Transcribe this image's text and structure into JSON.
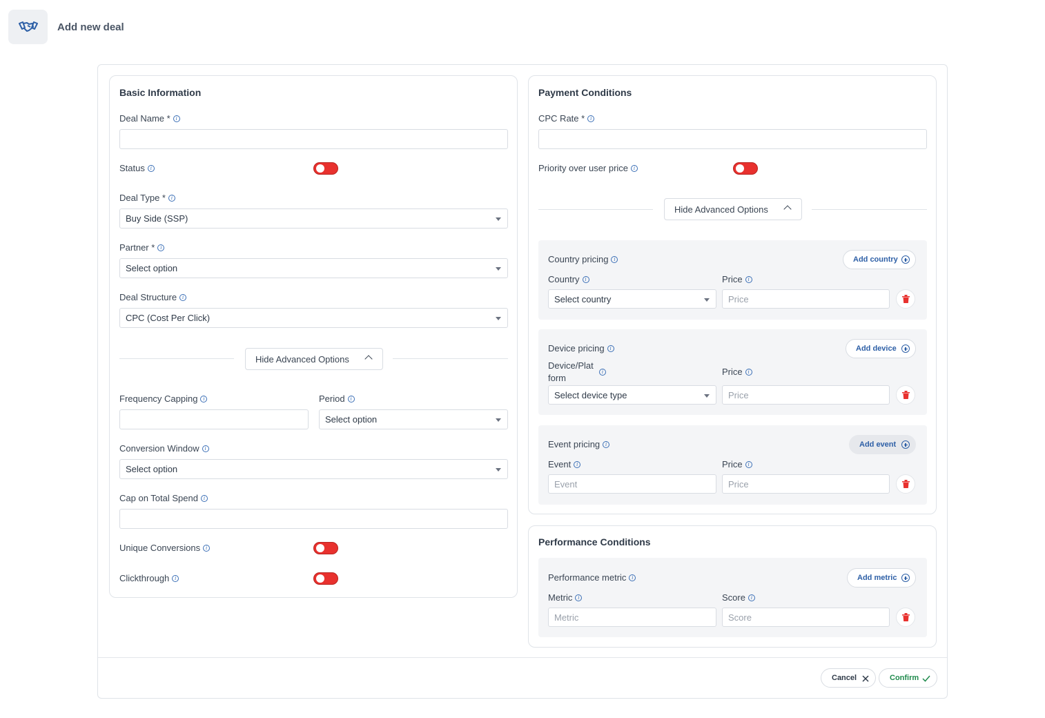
{
  "header": {
    "title": "Add new deal",
    "icon": "handshake-icon"
  },
  "basic": {
    "title": "Basic Information",
    "deal_name_label": "Deal Name *",
    "status_label": "Status",
    "deal_type_label": "Deal Type *",
    "deal_type_value": "Buy Side (SSP)",
    "partner_label": "Partner *",
    "partner_value": "Select option",
    "deal_structure_label": "Deal Structure",
    "deal_structure_value": "CPC (Cost Per Click)",
    "advanced_toggle": "Hide Advanced Options",
    "frequency_label": "Frequency Capping",
    "period_label": "Period",
    "period_value": "Select option",
    "conversion_window_label": "Conversion Window",
    "conversion_window_value": "Select option",
    "cap_label": "Cap on Total Spend",
    "unique_conversions_label": "Unique Conversions",
    "clickthrough_label": "Clickthrough"
  },
  "payment": {
    "title": "Payment Conditions",
    "cpc_label": "CPC Rate *",
    "priority_label": "Priority over user price",
    "advanced_toggle": "Hide Advanced Options",
    "country_pricing": {
      "title": "Country pricing",
      "add": "Add country",
      "field_label": "Country",
      "field_value": "Select country",
      "price_label": "Price",
      "price_placeholder": "Price"
    },
    "device_pricing": {
      "title": "Device pricing",
      "add": "Add device",
      "field_label_1": "Device/Plat",
      "field_label_2": "form",
      "field_value": "Select device type",
      "price_label": "Price",
      "price_placeholder": "Price"
    },
    "event_pricing": {
      "title": "Event pricing",
      "add": "Add event",
      "field_label": "Event",
      "field_placeholder": "Event",
      "price_label": "Price",
      "price_placeholder": "Price"
    }
  },
  "performance": {
    "title": "Performance Conditions",
    "metric_group": {
      "title": "Performance metric",
      "add": "Add metric",
      "metric_label": "Metric",
      "metric_placeholder": "Metric",
      "score_label": "Score",
      "score_placeholder": "Score"
    }
  },
  "footer": {
    "cancel": "Cancel",
    "confirm": "Confirm"
  },
  "colors": {
    "toggle_off": "#e8312e",
    "link_blue": "#2d5fa6",
    "confirm_green": "#1f8a4c",
    "danger": "#e8312e"
  }
}
